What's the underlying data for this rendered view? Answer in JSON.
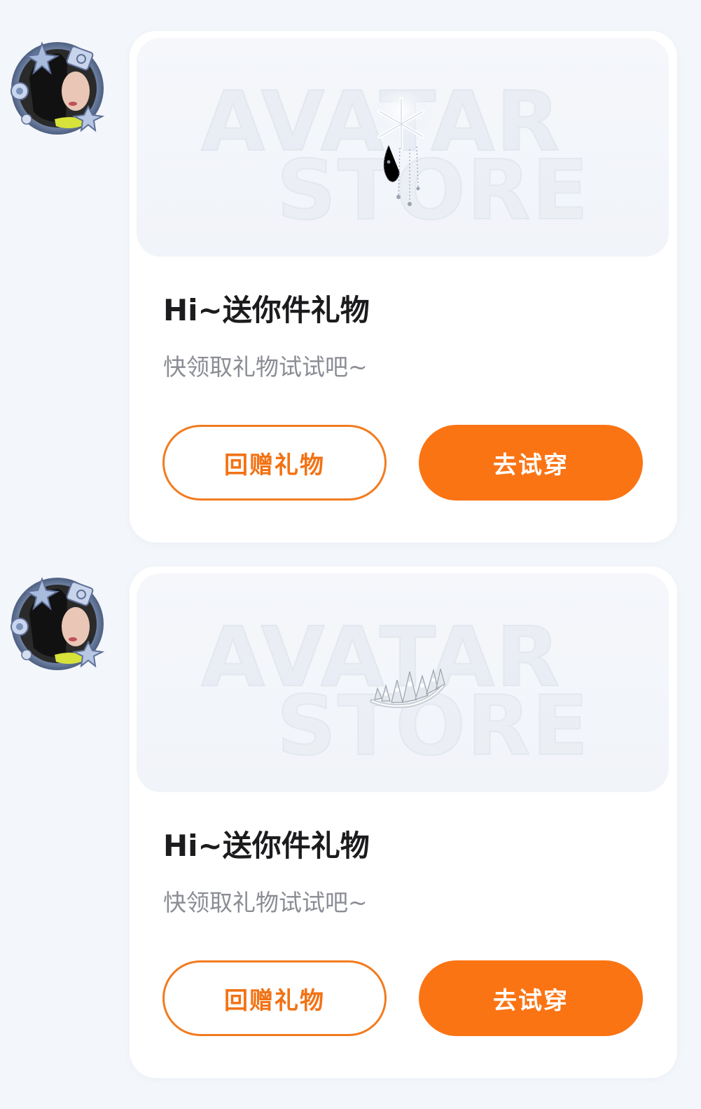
{
  "messages": [
    {
      "avatar_icon": "user-avatar-icon",
      "banner": {
        "watermark_line1": "AVATAR",
        "watermark_line2": "STORE",
        "item_icon": "snowflake-hairpin-icon"
      },
      "title": "Hi~送你件礼物",
      "subtitle": "快领取礼物试试吧~",
      "return_gift_label": "回赠礼物",
      "try_on_label": "去试穿"
    },
    {
      "avatar_icon": "user-avatar-icon",
      "banner": {
        "watermark_line1": "AVATAR",
        "watermark_line2": "STORE",
        "item_icon": "tiara-icon"
      },
      "title": "Hi~送你件礼物",
      "subtitle": "快领取礼物试试吧~",
      "return_gift_label": "回赠礼物",
      "try_on_label": "去试穿"
    }
  ],
  "colors": {
    "accent": "#fb7414",
    "outline": "#f27b20",
    "page_bg": "#f3f6fa",
    "card_bg": "#ffffff"
  }
}
